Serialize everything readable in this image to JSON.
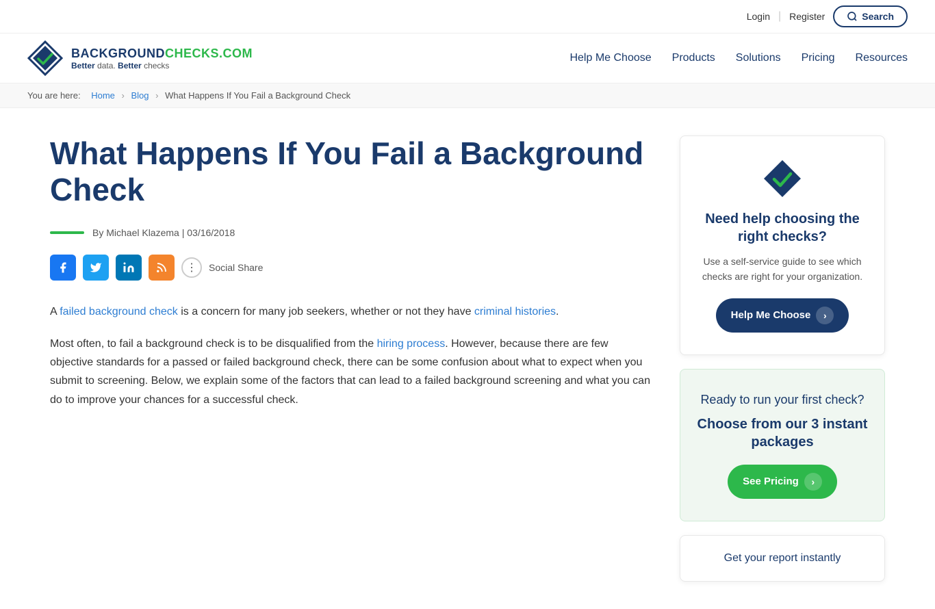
{
  "topbar": {
    "login_label": "Login",
    "register_label": "Register",
    "search_label": "Search"
  },
  "nav": {
    "logo_text_part1": "BACKGROUND",
    "logo_text_part2": "CHECKS.COM",
    "logo_tagline_part1": "Better",
    "logo_tagline_word1": " data. ",
    "logo_tagline_part2": "Better",
    "logo_tagline_word2": " checks",
    "links": [
      {
        "label": "Help Me Choose",
        "href": "#"
      },
      {
        "label": "Products",
        "href": "#"
      },
      {
        "label": "Solutions",
        "href": "#"
      },
      {
        "label": "Pricing",
        "href": "#"
      },
      {
        "label": "Resources",
        "href": "#"
      }
    ]
  },
  "breadcrumb": {
    "prefix": "You are here:",
    "home": "Home",
    "blog": "Blog",
    "current": "What Happens If You Fail a Background Check"
  },
  "article": {
    "title": "What Happens If You Fail a Background Check",
    "author": "By Michael Klazema | 03/16/2018",
    "social_share_label": "Social Share",
    "para1": "A failed background check is a concern for many job seekers, whether or not they have criminal histories.",
    "para2": "Most often, to fail a background check is to be disqualified from the hiring process. However, because there are few objective standards for a passed or failed background check, there can be some confusion about what to expect when you submit to screening. Below, we explain some of the factors that can lead to a failed background screening and what you can do to improve your chances for a successful check."
  },
  "sidebar": {
    "card1": {
      "title": "Need help choosing the right checks?",
      "desc": "Use a self-service guide to see which checks are right for your organization.",
      "cta": "Help Me Choose"
    },
    "card2": {
      "title": "Ready to run your first check?",
      "sub": "Choose from our 3 instant packages",
      "cta": "See Pricing"
    },
    "card3": {
      "text": "Get your report instantly"
    }
  }
}
